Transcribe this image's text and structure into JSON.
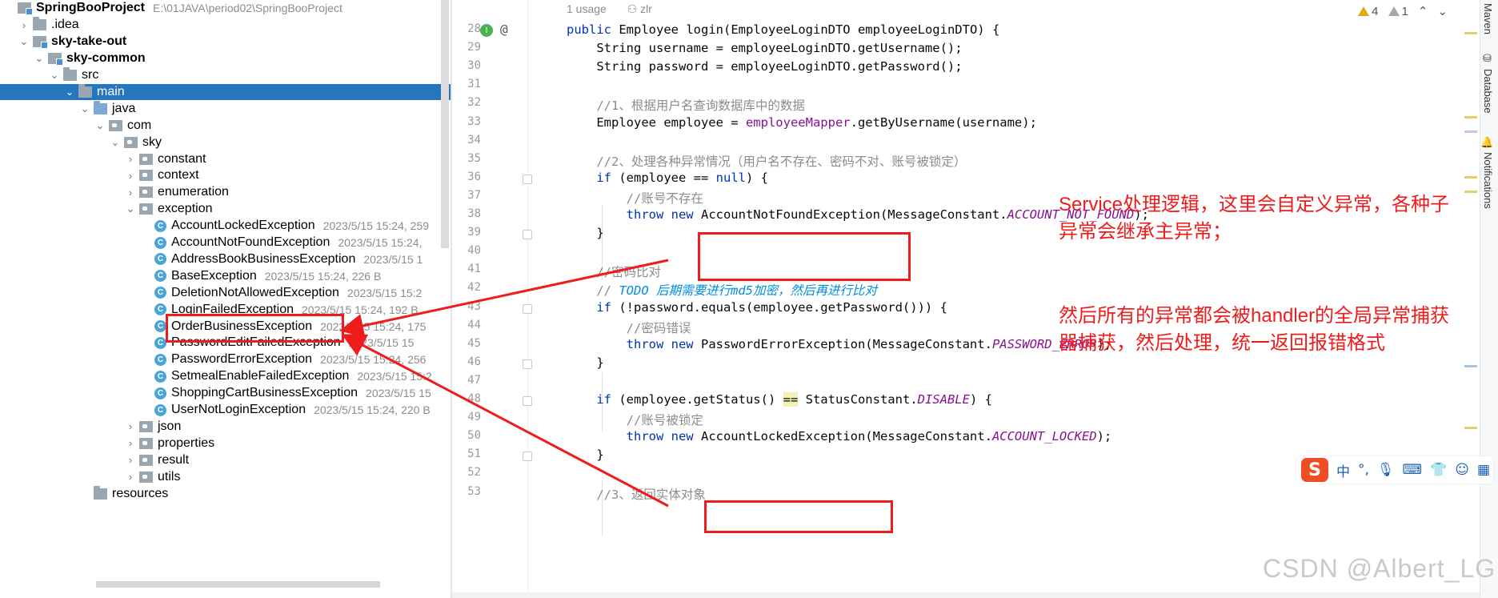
{
  "project_tree": [
    {
      "label": "SpringBooProject",
      "meta": "E:\\01JAVA\\period02\\SpringBooProject",
      "indent": 0,
      "arrow": "",
      "icon": "module",
      "bold": true
    },
    {
      "label": ".idea",
      "indent": 1,
      "arrow": "›",
      "icon": "folder"
    },
    {
      "label": "sky-take-out",
      "indent": 1,
      "arrow": "⌄",
      "icon": "module",
      "bold": true
    },
    {
      "label": "sky-common",
      "indent": 2,
      "arrow": "⌄",
      "icon": "module",
      "bold": true
    },
    {
      "label": "src",
      "indent": 3,
      "arrow": "⌄",
      "icon": "folder"
    },
    {
      "label": "main",
      "indent": 4,
      "arrow": "⌄",
      "icon": "folder",
      "selected": true
    },
    {
      "label": "java",
      "indent": 5,
      "arrow": "⌄",
      "icon": "folder-blue"
    },
    {
      "label": "com",
      "indent": 6,
      "arrow": "⌄",
      "icon": "pkg"
    },
    {
      "label": "sky",
      "indent": 7,
      "arrow": "⌄",
      "icon": "pkg"
    },
    {
      "label": "constant",
      "indent": 8,
      "arrow": "›",
      "icon": "pkg"
    },
    {
      "label": "context",
      "indent": 8,
      "arrow": "›",
      "icon": "pkg"
    },
    {
      "label": "enumeration",
      "indent": 8,
      "arrow": "›",
      "icon": "pkg"
    },
    {
      "label": "exception",
      "indent": 8,
      "arrow": "⌄",
      "icon": "pkg"
    },
    {
      "label": "AccountLockedException",
      "meta": "2023/5/15 15:24, 259",
      "indent": 9,
      "icon": "class"
    },
    {
      "label": "AccountNotFoundException",
      "meta": "2023/5/15 15:24,",
      "indent": 9,
      "icon": "class"
    },
    {
      "label": "AddressBookBusinessException",
      "meta": "2023/5/15 1",
      "indent": 9,
      "icon": "class"
    },
    {
      "label": "BaseException",
      "meta": "2023/5/15 15:24, 226 B",
      "indent": 9,
      "icon": "class"
    },
    {
      "label": "DeletionNotAllowedException",
      "meta": "2023/5/15 15:2",
      "indent": 9,
      "icon": "class"
    },
    {
      "label": "LoginFailedException",
      "meta": "2023/5/15 15:24, 192 B",
      "indent": 9,
      "icon": "class"
    },
    {
      "label": "OrderBusinessException",
      "meta": "2023/5/15 15:24, 175",
      "indent": 9,
      "icon": "class"
    },
    {
      "label": "PasswordEditFailedException",
      "meta": "2023/5/15 15",
      "indent": 9,
      "icon": "class"
    },
    {
      "label": "PasswordErrorException",
      "meta": "2023/5/15 15:24, 256",
      "indent": 9,
      "icon": "class"
    },
    {
      "label": "SetmealEnableFailedException",
      "meta": "2023/5/15 15:2",
      "indent": 9,
      "icon": "class"
    },
    {
      "label": "ShoppingCartBusinessException",
      "meta": "2023/5/15 15",
      "indent": 9,
      "icon": "class"
    },
    {
      "label": "UserNotLoginException",
      "meta": "2023/5/15 15:24, 220 B",
      "indent": 9,
      "icon": "class"
    },
    {
      "label": "json",
      "indent": 8,
      "arrow": "›",
      "icon": "pkg"
    },
    {
      "label": "properties",
      "indent": 8,
      "arrow": "›",
      "icon": "pkg"
    },
    {
      "label": "result",
      "indent": 8,
      "arrow": "›",
      "icon": "pkg"
    },
    {
      "label": "utils",
      "indent": 8,
      "arrow": "›",
      "icon": "pkg"
    },
    {
      "label": "resources",
      "indent": 5,
      "arrow": "",
      "icon": "folder"
    }
  ],
  "editor": {
    "usage_hint": "1 usage",
    "author": "zlr",
    "warnings": "4",
    "weak_warnings": "1",
    "line_numbers": [
      "28",
      "29",
      "30",
      "31",
      "32",
      "33",
      "34",
      "35",
      "36",
      "37",
      "38",
      "39",
      "40",
      "41",
      "42",
      "43",
      "44",
      "45",
      "46",
      "47",
      "48",
      "49",
      "50",
      "51",
      "52",
      "53"
    ],
    "lines": [
      [
        {
          "t": "public ",
          "c": "kw"
        },
        {
          "t": "Employee "
        },
        {
          "t": "login",
          "c": "fn"
        },
        {
          "t": "(EmployeeLoginDTO employeeLoginDTO) {"
        }
      ],
      [
        {
          "t": "    String username = employeeLoginDTO.getUsername();"
        }
      ],
      [
        {
          "t": "    String password = employeeLoginDTO.getPassword();"
        }
      ],
      [
        {
          "t": ""
        }
      ],
      [
        {
          "t": "    //1、根据用户名查询数据库中的数据",
          "c": "cm"
        }
      ],
      [
        {
          "t": "    Employee employee = "
        },
        {
          "t": "employeeMapper",
          "c": "field"
        },
        {
          "t": ".getByUsername(username);"
        }
      ],
      [
        {
          "t": ""
        }
      ],
      [
        {
          "t": "    //2、处理各种异常情况（用户名不存在、密码不对、账号被锁定）",
          "c": "cm"
        }
      ],
      [
        {
          "t": "    "
        },
        {
          "t": "if ",
          "c": "kw"
        },
        {
          "t": "(employee == "
        },
        {
          "t": "null",
          "c": "kw"
        },
        {
          "t": ") {"
        }
      ],
      [
        {
          "t": "        //账号不存在",
          "c": "cm"
        }
      ],
      [
        {
          "t": "        "
        },
        {
          "t": "throw new ",
          "c": "kw"
        },
        {
          "t": "AccountNotFoundException(MessageConstant."
        },
        {
          "t": "ACCOUNT_NOT_FOUND",
          "c": "const"
        },
        {
          "t": ");"
        }
      ],
      [
        {
          "t": "    }"
        }
      ],
      [
        {
          "t": ""
        }
      ],
      [
        {
          "t": "    //密码比对",
          "c": "cm"
        }
      ],
      [
        {
          "t": "    // ",
          "c": "cm"
        },
        {
          "t": "TODO 后期需要进行md5加密，然后再进行比对",
          "c": "todo"
        }
      ],
      [
        {
          "t": "    "
        },
        {
          "t": "if ",
          "c": "kw"
        },
        {
          "t": "(!password.equals(employee.getPassword())) {"
        }
      ],
      [
        {
          "t": "        //密码错误",
          "c": "cm"
        }
      ],
      [
        {
          "t": "        "
        },
        {
          "t": "throw new ",
          "c": "kw"
        },
        {
          "t": "PasswordErrorException(MessageConstant."
        },
        {
          "t": "PASSWORD_ERROR",
          "c": "const"
        },
        {
          "t": ");"
        }
      ],
      [
        {
          "t": "    }"
        }
      ],
      [
        {
          "t": ""
        }
      ],
      [
        {
          "t": "    "
        },
        {
          "t": "if ",
          "c": "kw"
        },
        {
          "t": "(employee.getStatus() "
        },
        {
          "t": "==",
          "c": "hl"
        },
        {
          "t": " StatusConstant."
        },
        {
          "t": "DISABLE",
          "c": "const"
        },
        {
          "t": ") {"
        }
      ],
      [
        {
          "t": "        //账号被锁定",
          "c": "cm"
        }
      ],
      [
        {
          "t": "        "
        },
        {
          "t": "throw new ",
          "c": "kw"
        },
        {
          "t": "AccountLockedException(MessageConstant."
        },
        {
          "t": "ACCOUNT_LOCKED",
          "c": "const"
        },
        {
          "t": ");"
        }
      ],
      [
        {
          "t": "    }"
        }
      ],
      [
        {
          "t": ""
        }
      ],
      [
        {
          "t": "    //3、返回实体对象",
          "c": "cm"
        }
      ]
    ]
  },
  "annotations": {
    "note1_line1": "Service处理逻辑，这里会自定义异常，各种子",
    "note1_line2": "异常会继承主异常；",
    "note2_line1": "然后所有的异常都会被handler的全局异常捕获",
    "note2_line2": "器捕获，然后处理，统一返回报错格式",
    "box_color": "#ee1c1c"
  },
  "right_tabs": {
    "maven": "Maven",
    "database": "Database",
    "notifications": "Notifications"
  },
  "ime": {
    "lang": "中",
    "punct": "°,",
    "icons": [
      "mic-icon",
      "keyboard-icon",
      "skin-icon",
      "emoji-icon",
      "apps-icon"
    ]
  },
  "watermark": "CSDN @Albert_LG"
}
